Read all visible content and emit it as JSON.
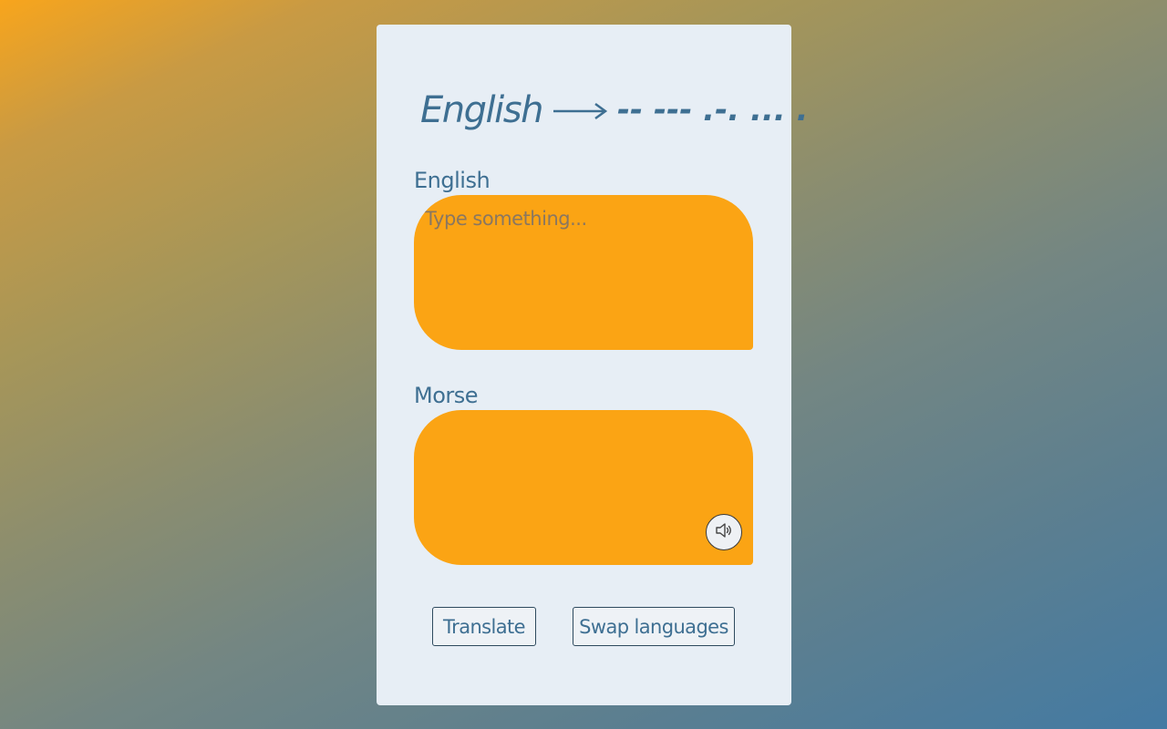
{
  "title": {
    "source": "English",
    "target": "-- --- .-. ... ."
  },
  "english": {
    "label": "English",
    "placeholder": "Type something...",
    "value": ""
  },
  "morse": {
    "label": "Morse",
    "value": ""
  },
  "actions": {
    "translate_label": "Translate",
    "swap_label": "Swap languages"
  },
  "icons": {
    "arrow": "long-right-arrow-icon",
    "speaker": "speaker-icon"
  },
  "colors": {
    "accent": "#fba414",
    "text": "#3e6f92",
    "card": "#e7eef5"
  }
}
